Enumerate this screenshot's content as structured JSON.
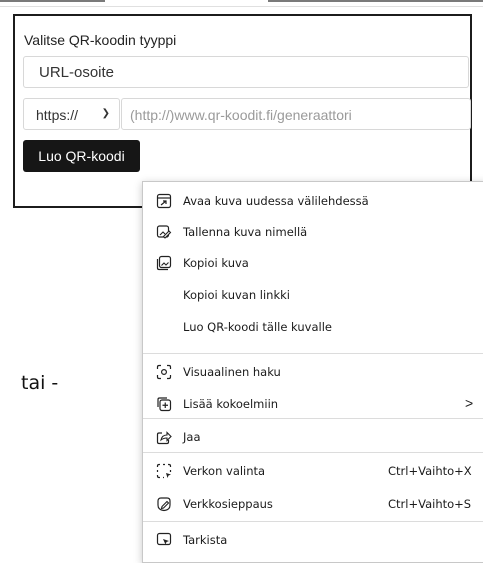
{
  "form": {
    "title": "Valitse QR-koodin tyyppi",
    "type_value": "URL-osoite",
    "protocol_value": "https://",
    "url_placeholder": "(http://)www.qr-koodit.fi/generaattori",
    "create_button": "Luo QR-koodi"
  },
  "side_text": "tai -",
  "context_menu": {
    "items": [
      {
        "label": "Avaa kuva uudessa välilehdessä",
        "icon": "open-in-new-tab-icon"
      },
      {
        "label": "Tallenna kuva nimellä",
        "icon": "save-image-icon"
      },
      {
        "label": "Kopioi kuva",
        "icon": "copy-image-icon"
      },
      {
        "label": "Kopioi kuvan linkki",
        "icon": ""
      },
      {
        "label": "Luo QR-koodi tälle kuvalle",
        "icon": ""
      },
      {
        "label": "Visuaalinen haku",
        "icon": "visual-search-icon"
      },
      {
        "label": "Lisää kokoelmiin",
        "icon": "collections-icon",
        "submenu": ">"
      },
      {
        "label": "Jaa",
        "icon": "share-icon"
      },
      {
        "label": "Verkon valinta",
        "icon": "web-select-icon",
        "shortcut": "Ctrl+Vaihto+X"
      },
      {
        "label": "Verkkosieppaus",
        "icon": "web-capture-icon",
        "shortcut": "Ctrl+Vaihto+S"
      },
      {
        "label": "Tarkista",
        "icon": "inspect-icon"
      }
    ]
  }
}
